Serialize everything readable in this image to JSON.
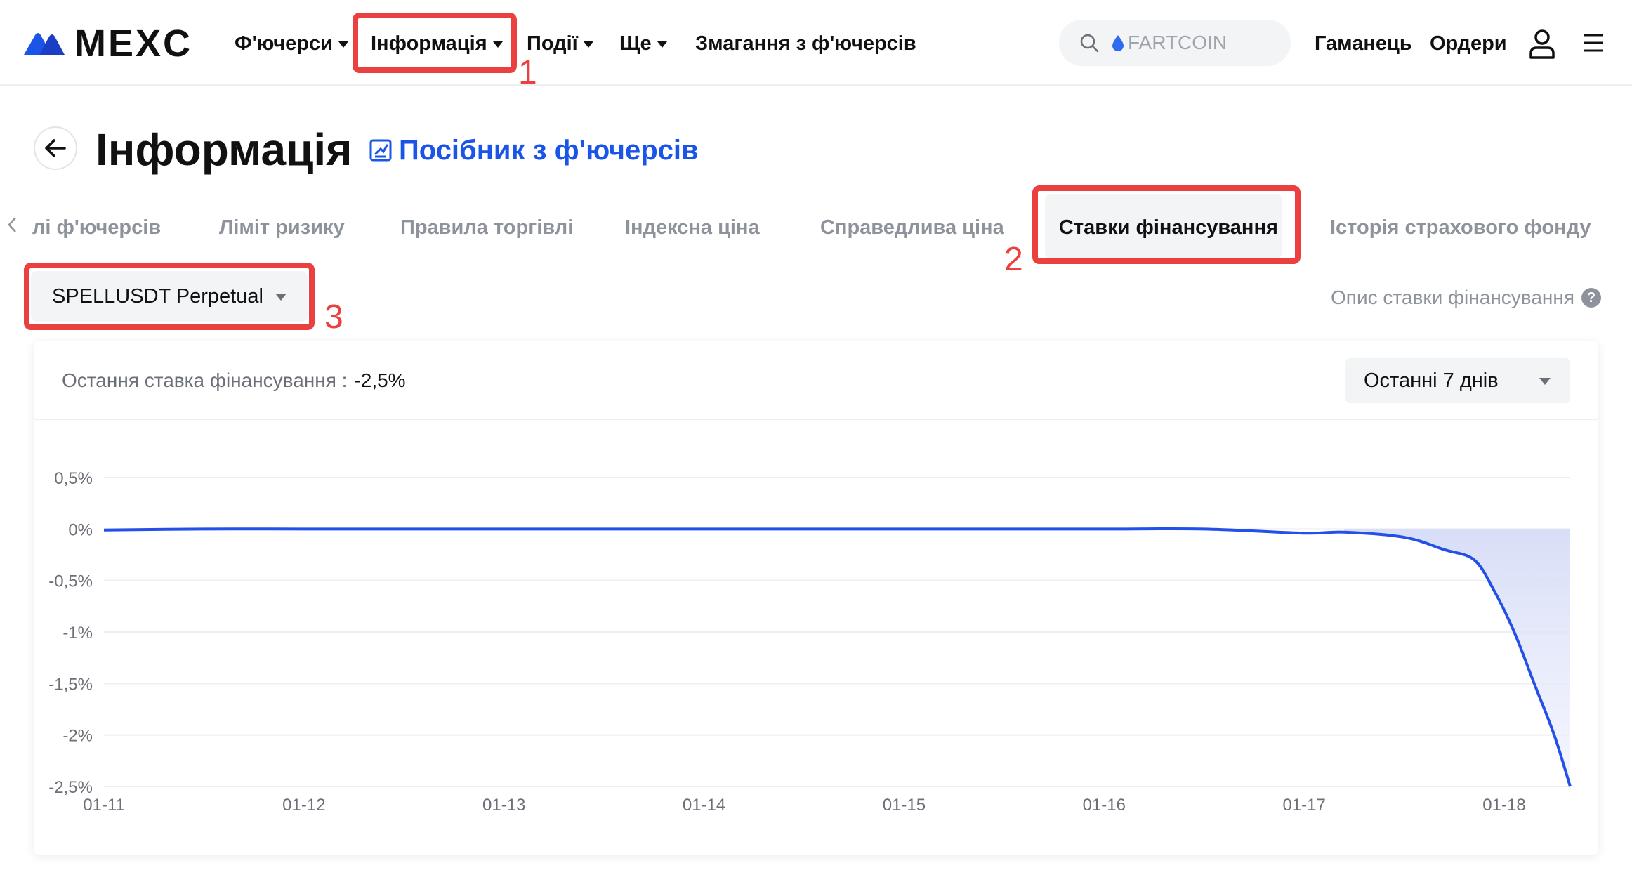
{
  "header": {
    "logo_text": "MEXC",
    "nav": [
      {
        "label": "Ф'ючерси",
        "has_caret": true
      },
      {
        "label": "Інформація",
        "has_caret": true
      },
      {
        "label": "Події",
        "has_caret": true
      },
      {
        "label": "Ще",
        "has_caret": true
      },
      {
        "label": "Змагання з ф'ючерсів",
        "has_caret": false
      }
    ],
    "search_placeholder": "FARTCOIN",
    "wallet_label": "Гаманець",
    "orders_label": "Ордери",
    "icons": {
      "search": "search-icon",
      "user": "user-icon",
      "menu": "hamburger-menu-icon"
    }
  },
  "annotations": [
    "1",
    "2",
    "3"
  ],
  "page": {
    "title": "Інформація",
    "guide_link": "Посібник з ф'ючерсів"
  },
  "tabs": [
    "лі ф'ючерсів",
    "Ліміт ризику",
    "Правила торгівлі",
    "Індексна ціна",
    "Справедлива ціна",
    "Ставки фінансування",
    "Історія страхового фонду"
  ],
  "active_tab": "Ставки фінансування",
  "symbol_select": "SPELLUSDT Perpetual",
  "funding_desc_link": "Опис ставки фінансування",
  "card": {
    "last_rate_label": "Остання ставка фінансування :",
    "last_rate_value": "-2,5%",
    "range_select": "Останні 7 днів"
  },
  "colors": {
    "accent_blue": "#1a55e8",
    "line": "#2450e8",
    "annotation_red": "#ea4040"
  },
  "chart_data": {
    "type": "area",
    "title": "",
    "xlabel": "",
    "ylabel": "",
    "x_tick_labels": [
      "01-11",
      "01-12",
      "01-13",
      "01-14",
      "01-15",
      "01-16",
      "01-17",
      "01-18"
    ],
    "y_tick_labels": [
      "0,5%",
      "0%",
      "-0,5%",
      "-1%",
      "-1,5%",
      "-2%",
      "-2,5%"
    ],
    "ylim": [
      -2.5,
      0.5
    ],
    "xlim": [
      0,
      7.33
    ],
    "grid": true,
    "series": [
      {
        "x": [
          0,
          0.5,
          1,
          2,
          3,
          4,
          5,
          5.5,
          6.0,
          6.2,
          6.5,
          6.7,
          6.85,
          6.95,
          7.05,
          7.15,
          7.25,
          7.33
        ],
        "y": [
          -0.01,
          0.0,
          0.0,
          0.0,
          0.0,
          0.0,
          0.0,
          0.0,
          -0.04,
          -0.03,
          -0.08,
          -0.2,
          -0.3,
          -0.6,
          -1.0,
          -1.5,
          -2.0,
          -2.5
        ]
      }
    ]
  }
}
